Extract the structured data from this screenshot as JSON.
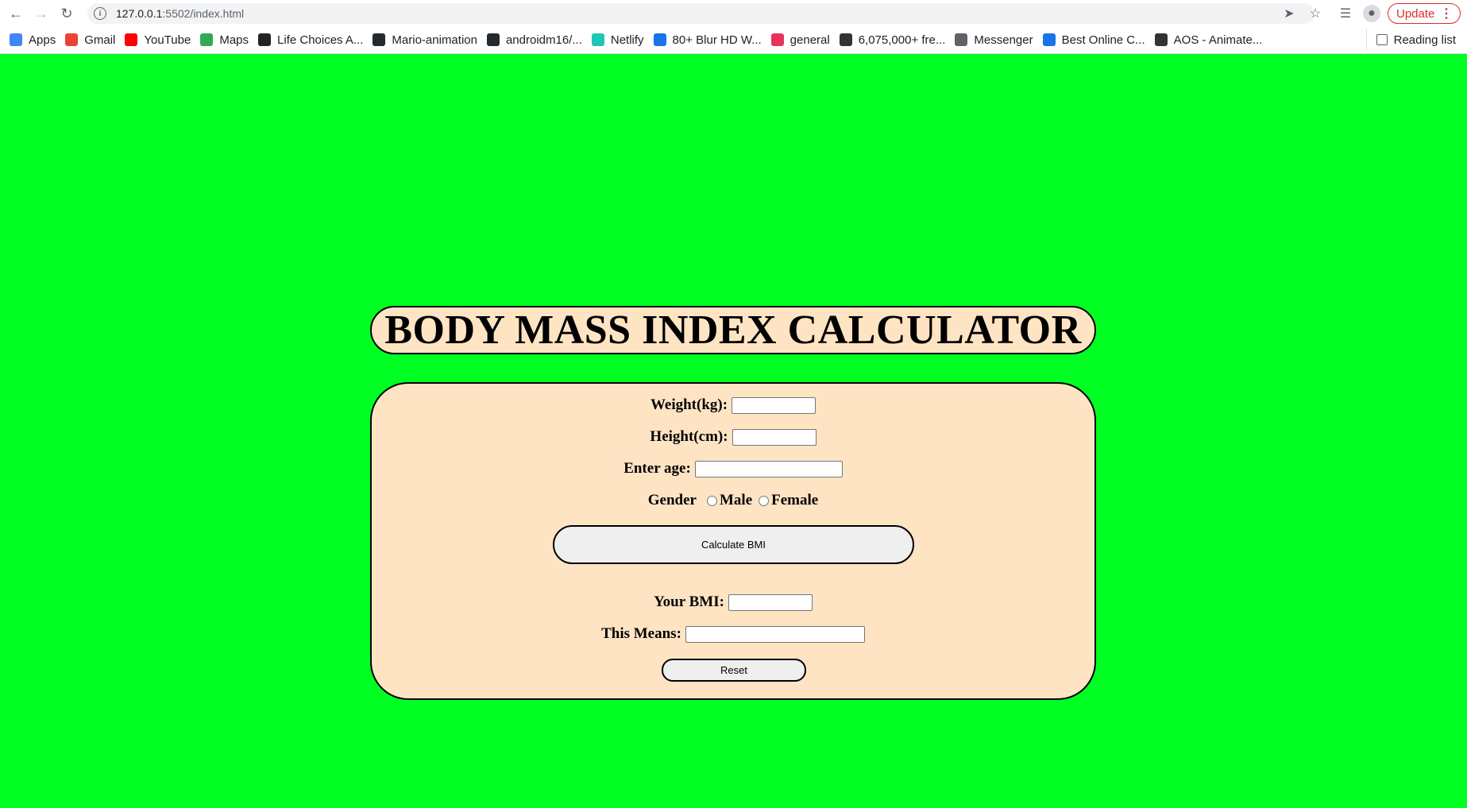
{
  "browser": {
    "url_host": "127.0.0.1",
    "url_rest": ":5502/index.html",
    "update_label": "Update",
    "bookmarks": [
      {
        "label": "Apps",
        "icon": "apps-grid-icon",
        "color": "#4285f4"
      },
      {
        "label": "Gmail",
        "icon": "gmail-icon",
        "color": "#ea4335"
      },
      {
        "label": "YouTube",
        "icon": "youtube-icon",
        "color": "#ff0000"
      },
      {
        "label": "Maps",
        "icon": "maps-icon",
        "color": "#34a853"
      },
      {
        "label": "Life Choices A...",
        "icon": "life-choices-icon",
        "color": "#222222"
      },
      {
        "label": "Mario-animation",
        "icon": "github-icon",
        "color": "#24292e"
      },
      {
        "label": "androidm16/...",
        "icon": "github-icon",
        "color": "#24292e"
      },
      {
        "label": "Netlify",
        "icon": "netlify-icon",
        "color": "#20c6b7"
      },
      {
        "label": "80+ Blur HD W...",
        "icon": "wallpaper-icon",
        "color": "#1a73e8"
      },
      {
        "label": "general",
        "icon": "discord-icon",
        "color": "#e8325a"
      },
      {
        "label": "6,075,000+ fre...",
        "icon": "freepik-icon",
        "color": "#333333"
      },
      {
        "label": "Messenger",
        "icon": "messenger-icon",
        "color": "#5f6368"
      },
      {
        "label": "Best Online C...",
        "icon": "document-icon",
        "color": "#1a73e8"
      },
      {
        "label": "AOS - Animate...",
        "icon": "aos-icon",
        "color": "#333333"
      }
    ],
    "reading_list_label": "Reading list"
  },
  "page": {
    "title": "BODY MASS INDEX CALCULATOR",
    "weight_label": "Weight(kg):",
    "height_label": "Height(cm):",
    "age_label": "Enter age:",
    "gender_label": "Gender",
    "male_label": "Male",
    "female_label": "Female",
    "calculate_label": "Calculate BMI",
    "bmi_label": "Your BMI:",
    "means_label": "This Means:",
    "reset_label": "Reset",
    "weight_value": "",
    "height_value": "",
    "age_value": "",
    "bmi_value": "",
    "means_value": ""
  },
  "colors": {
    "background": "#00ff22",
    "panel": "#ffe4c4"
  }
}
